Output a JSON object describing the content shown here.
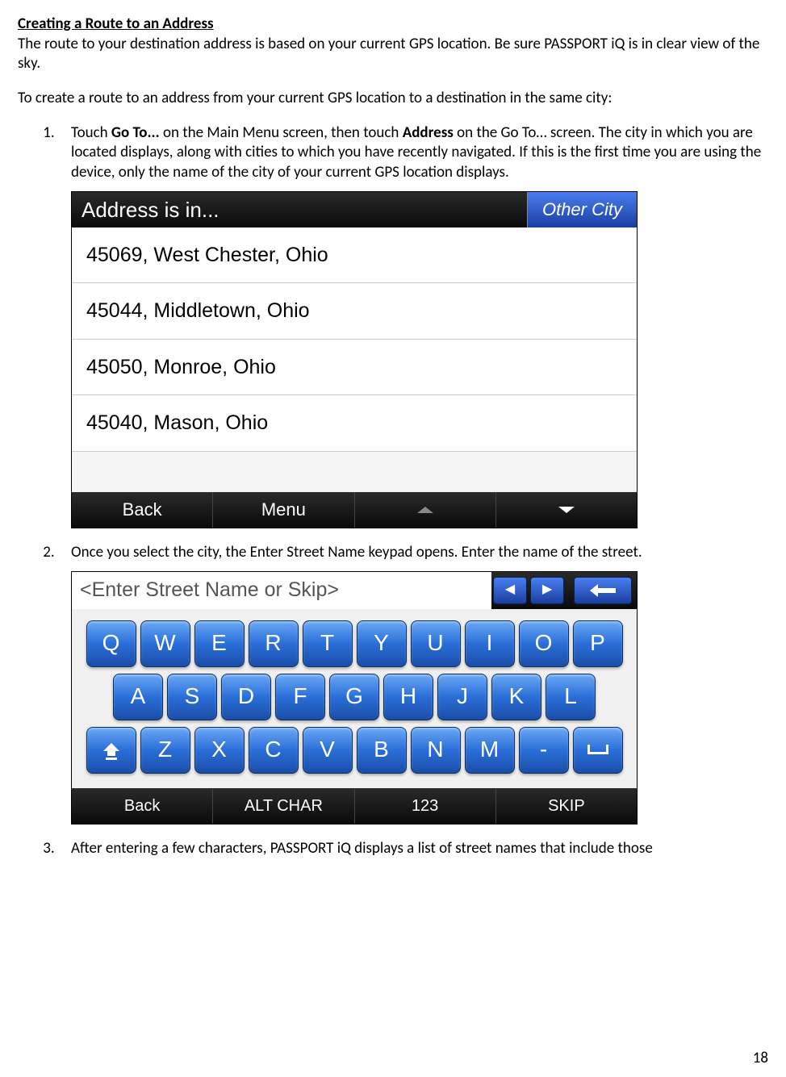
{
  "title": "Creating a Route to an Address",
  "intro": "The route to your destination address is based on your current GPS location. Be sure PASSPORT iQ is in clear view of the sky.",
  "lead": "To create a route to an address from your current GPS location to a destination in the same city:",
  "steps": {
    "one_a": "Touch ",
    "one_b": "Go To...",
    "one_c": " on the Main Menu screen, then touch ",
    "one_d": "Address",
    "one_e": " on the Go To… screen. The city in which you are located displays, along with cities to which you have recently navigated. If this is the first time you are using the device, only the name of the city of your current GPS location displays.",
    "two": "Once you select the city, the Enter Street Name keypad opens. Enter the name of the street.",
    "three": "After entering a few characters, PASSPORT iQ displays a list of street names that include those"
  },
  "address_screen": {
    "header": "Address is in...",
    "other_city": "Other City",
    "cities": [
      "45069, West Chester, Ohio",
      "45044, Middletown, Ohio",
      "45050, Monroe, Ohio",
      "45040, Mason, Ohio"
    ],
    "footer": {
      "back": "Back",
      "menu": "Menu"
    }
  },
  "keyboard_screen": {
    "prompt": "<Enter Street Name or Skip>",
    "rows": {
      "r1": [
        "Q",
        "W",
        "E",
        "R",
        "T",
        "Y",
        "U",
        "I",
        "O",
        "P"
      ],
      "r2": [
        "A",
        "S",
        "D",
        "F",
        "G",
        "H",
        "J",
        "K",
        "L"
      ],
      "r3_special_left": "⇩",
      "r3": [
        "Z",
        "X",
        "C",
        "V",
        "B",
        "N",
        "M",
        "-"
      ],
      "r3_special_right": "␣"
    },
    "footer": {
      "back": "Back",
      "alt": "ALT CHAR",
      "num": "123",
      "skip": "SKIP"
    },
    "backspace": "⟵"
  },
  "page": "18"
}
